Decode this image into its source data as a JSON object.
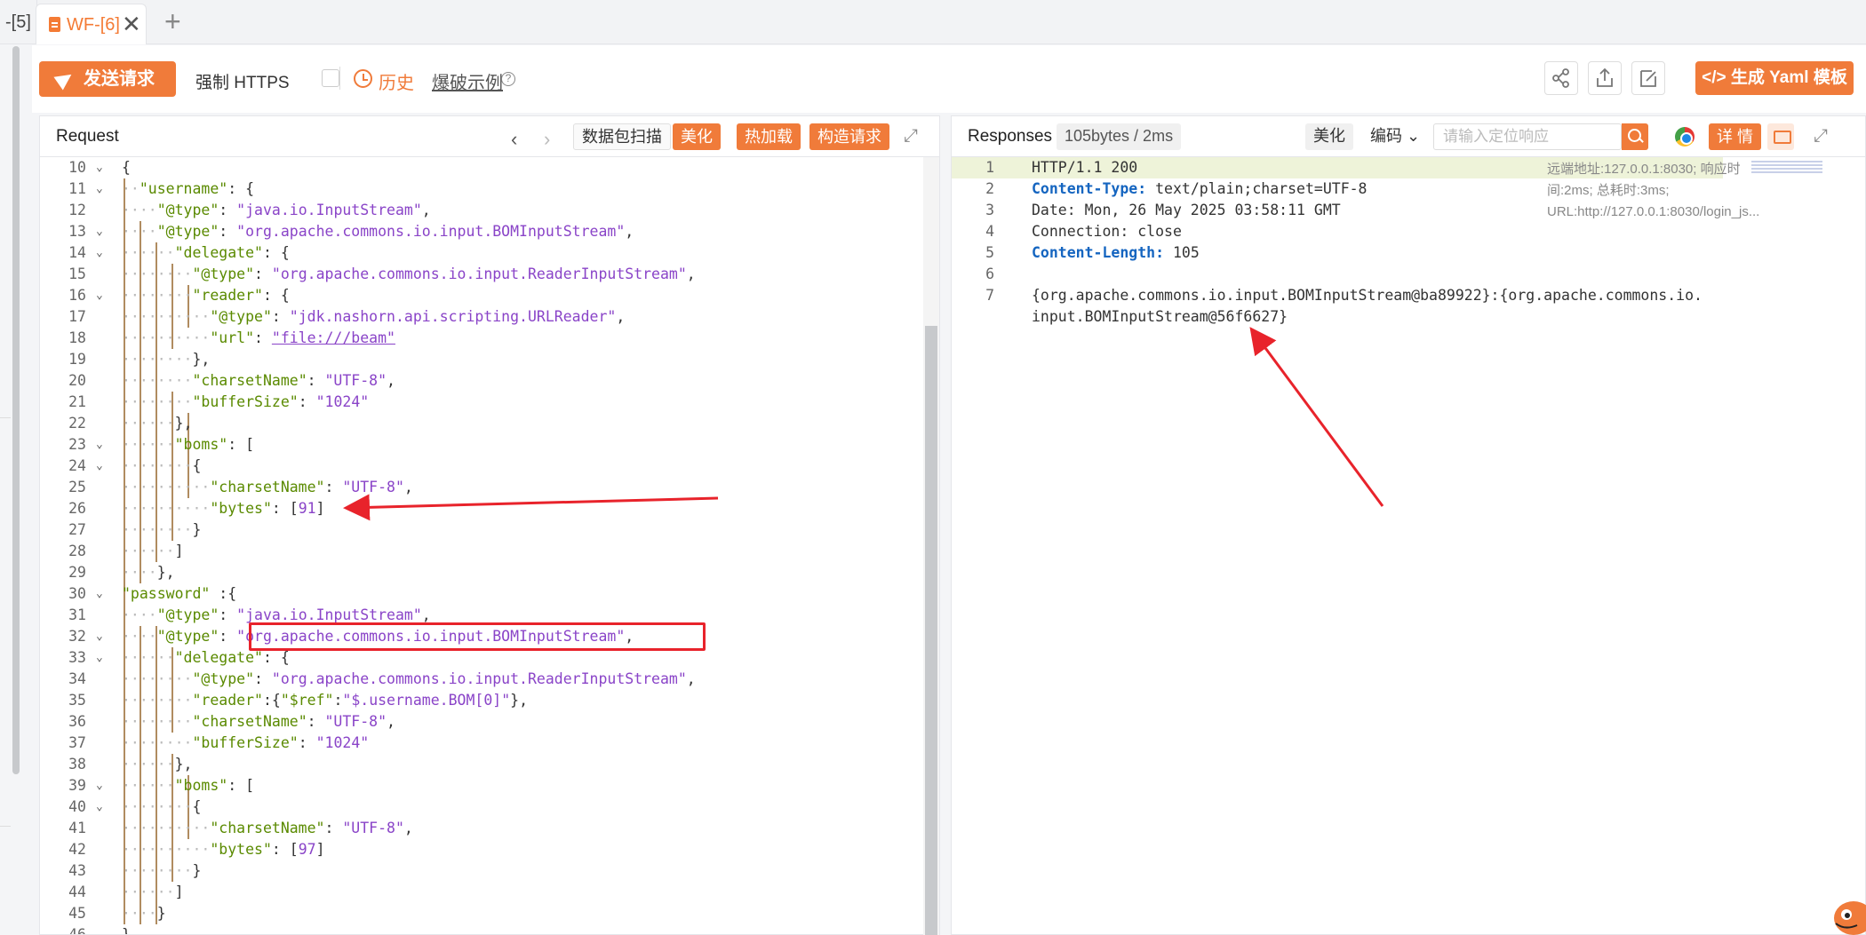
{
  "tabs": {
    "prev_label": "-[5]",
    "active_label": "WF-[6]",
    "close": "✕",
    "add": "+"
  },
  "toolbar": {
    "send_label": "发送请求",
    "https_label": "强制 HTTPS",
    "history_label": "历史",
    "burst_label": "爆破示例",
    "help": "?",
    "yaml_label": "</> 生成 Yaml 模板"
  },
  "request": {
    "title": "Request",
    "prev": "‹",
    "next": "›",
    "scan_label": "数据包扫描",
    "beautify_label": "美化",
    "hotload_label": "热加载",
    "construct_label": "构造请求",
    "lines": [
      {
        "n": "10",
        "fold": true
      },
      {
        "n": "11",
        "fold": true
      },
      {
        "n": "12"
      },
      {
        "n": "13",
        "fold": true
      },
      {
        "n": "14",
        "fold": true
      },
      {
        "n": "15"
      },
      {
        "n": "16",
        "fold": true
      },
      {
        "n": "17"
      },
      {
        "n": "18"
      },
      {
        "n": "19"
      },
      {
        "n": "20"
      },
      {
        "n": "21"
      },
      {
        "n": "22"
      },
      {
        "n": "23",
        "fold": true
      },
      {
        "n": "24",
        "fold": true
      },
      {
        "n": "25"
      },
      {
        "n": "26"
      },
      {
        "n": "27"
      },
      {
        "n": "28"
      },
      {
        "n": "29"
      },
      {
        "n": "30",
        "fold": true
      },
      {
        "n": "31"
      },
      {
        "n": "32",
        "fold": true
      },
      {
        "n": "33",
        "fold": true
      },
      {
        "n": "34"
      },
      {
        "n": "35"
      },
      {
        "n": "36"
      },
      {
        "n": "37"
      },
      {
        "n": "38"
      },
      {
        "n": "39",
        "fold": true
      },
      {
        "n": "40",
        "fold": true
      },
      {
        "n": "41"
      },
      {
        "n": "42"
      },
      {
        "n": "43"
      },
      {
        "n": "44"
      },
      {
        "n": "45"
      },
      {
        "n": "46"
      }
    ]
  },
  "response": {
    "title": "Responses",
    "size_badge": "105bytes / 2ms",
    "beautify_label": "美化",
    "encode_label": "编码",
    "search_placeholder": "请输入定位响应",
    "detail_label": "详 情",
    "meta": "远端地址:127.0.0.1:8030; 响应时间:2ms; 总耗时:3ms; URL:http://127.0.0.1:8030/login_js...",
    "lines": [
      "1",
      "2",
      "3",
      "4",
      "5",
      "6",
      "7"
    ],
    "status_line": "HTTP/1.1 200",
    "h_ct_key": "Content-Type:",
    "h_ct_val": "text/plain;charset=UTF-8",
    "h_date": "Date: Mon, 26 May 2025 03:58:11 GMT",
    "h_conn": "Connection: close",
    "h_cl_key": "Content-Length:",
    "h_cl_val": "105",
    "body_1": "{org.apache.commons.io.input.BOMInputStream@ba89922}:{org.apache.commons.io.",
    "body_2": "input.BOMInputStream@56f6627}"
  },
  "colors": {
    "accent": "#f07b3a",
    "annotation_red": "#e8232b"
  }
}
